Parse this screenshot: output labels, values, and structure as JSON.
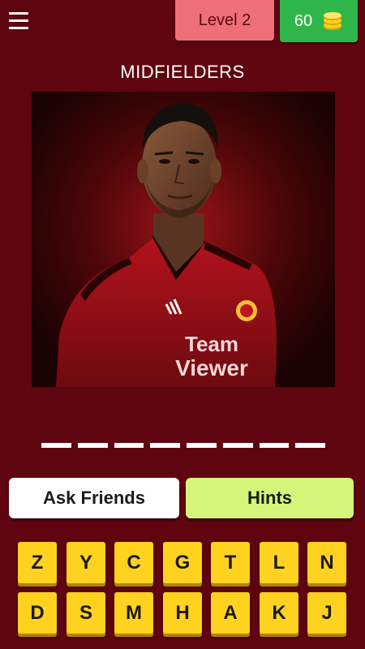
{
  "header": {
    "menu_icon": "hamburger-menu-icon",
    "level_label": "Level 2",
    "coins": "60",
    "coin_icon": "coin-stack-icon",
    "level_color": "#ef6f78",
    "coins_color": "#2fb64b"
  },
  "quiz": {
    "category": "MIDFIELDERS",
    "answer_length": 8,
    "photo": {
      "jersey_sponsor_line1": "Team",
      "jersey_sponsor_line2": "Viewer"
    }
  },
  "actions": {
    "ask_friends_label": "Ask Friends",
    "hints_label": "Hints"
  },
  "keyboard": {
    "rows": [
      [
        "Z",
        "Y",
        "C",
        "G",
        "T",
        "L",
        "N"
      ],
      [
        "D",
        "S",
        "M",
        "H",
        "A",
        "K",
        "J"
      ]
    ],
    "key_color": "#ffd21f"
  },
  "colors": {
    "background": "#5e0510",
    "hints_button": "#d4f57a",
    "ask_button": "#ffffff"
  }
}
